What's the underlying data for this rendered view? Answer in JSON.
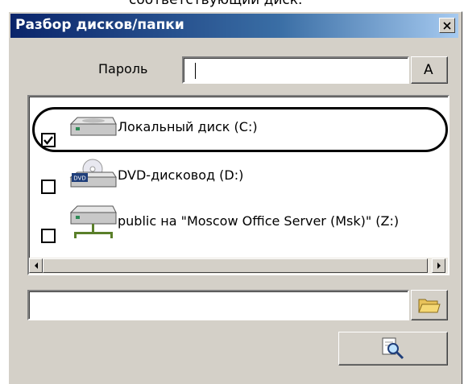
{
  "partial_text": "соответствующий диск.",
  "window": {
    "title": "Разбор дисков/папки"
  },
  "password": {
    "label": "Пароль",
    "value": "",
    "button_label": "A"
  },
  "drives": [
    {
      "label": "Локальный диск (C:)",
      "checked": true,
      "icon": "hard-drive-icon"
    },
    {
      "label": "DVD-дисковод (D:)",
      "checked": false,
      "icon": "dvd-drive-icon"
    },
    {
      "label": "public на \"Moscow Office Server (Msk)\" (Z:)",
      "checked": false,
      "icon": "network-drive-icon"
    }
  ],
  "path": {
    "value": "",
    "browse_icon": "folder-icon"
  },
  "search_button": {
    "icon": "magnifier-icon"
  }
}
